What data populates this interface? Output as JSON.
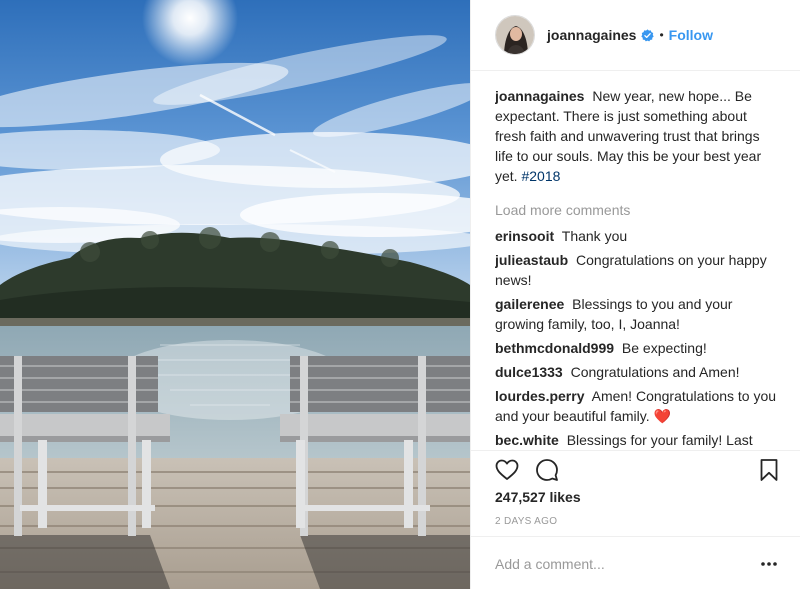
{
  "post": {
    "author": "joannagaines",
    "follow_label": "Follow",
    "separator": "•",
    "caption": {
      "user": "joannagaines",
      "text": "New year, new hope... Be expectant. There is just something about fresh faith and unwavering trust that brings life to our souls. May this be your best year yet.",
      "hashtag": "#2018"
    },
    "load_more": "Load more comments",
    "comments": [
      {
        "user": "erinsooit",
        "text": "Thank you"
      },
      {
        "user": "julieastaub",
        "text": "Congratulations on your happy news!"
      },
      {
        "user": "gailerenee",
        "text": "Blessings to you and your growing family, too, I, Joanna!"
      },
      {
        "user": "bethmcdonald999",
        "text": "Be expecting!"
      },
      {
        "user": "dulce1333",
        "text": "Congratulations and Amen!"
      },
      {
        "user": "lourdes.perry",
        "text": "Amen! Congratulations to you and your beautiful family.",
        "emoji": "❤️"
      },
      {
        "user": "bec.white",
        "text": "Blessings for your family! Last year I was going to have my first visit to Waco and the Silos but had to cancel when"
      }
    ],
    "likes": "247,527 likes",
    "date": "2 DAYS AGO",
    "add_comment_placeholder": "Add a comment..."
  },
  "icons": {
    "verified": "verified-badge-icon",
    "like": "heart-outline-icon",
    "comment": "speech-bubble-icon",
    "save": "bookmark-icon",
    "more": "ellipsis-icon"
  },
  "colors": {
    "link_blue": "#3897f0",
    "hashtag": "#003569",
    "muted": "#999999",
    "text": "#262626",
    "heart": "#ed4956"
  }
}
